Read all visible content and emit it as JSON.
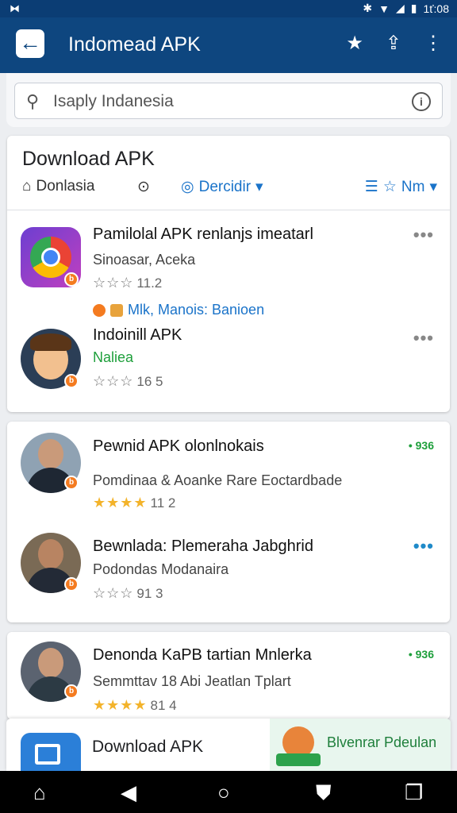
{
  "status_bar": {
    "time": "1ť:08"
  },
  "app_bar": {
    "title": "Indomead APK"
  },
  "search": {
    "value": "Isaply Indanesia"
  },
  "card1": {
    "title": "Download APK",
    "filters": {
      "f1": "Donlasia",
      "f3": "Dercidir",
      "f4": "Nm"
    },
    "items": [
      {
        "title": "Pamilolal APK renlanjs imeatarl",
        "subtitle": "Sinoasar, Aceka",
        "rating": "11.2"
      },
      {
        "title": "Indoinill APK",
        "subtitle": "Naliea",
        "rating": "16 5"
      }
    ],
    "links_text": "Mlk, Manois: Banioen"
  },
  "card2": {
    "items": [
      {
        "title": "Pewnid APK olonlnokais",
        "subtitle": "Pomdinaa & Aoanke Rare Eoctardbade",
        "rating": "11 2",
        "tag": "936"
      },
      {
        "title": "Bewnlada: Plemeraha Jabghrid",
        "subtitle": "Podondas Modanaira",
        "rating": "91 3"
      }
    ]
  },
  "card3": {
    "items": [
      {
        "title": "Denonda KaPB tartian Mnlerka",
        "subtitle": "Semmttav 18 Abi Jeatlan Tplart",
        "rating": "81 4",
        "tag": "936"
      }
    ]
  },
  "bottom_card": {
    "title": "Download APK",
    "promo": "Blvenrar Pdeulan"
  }
}
